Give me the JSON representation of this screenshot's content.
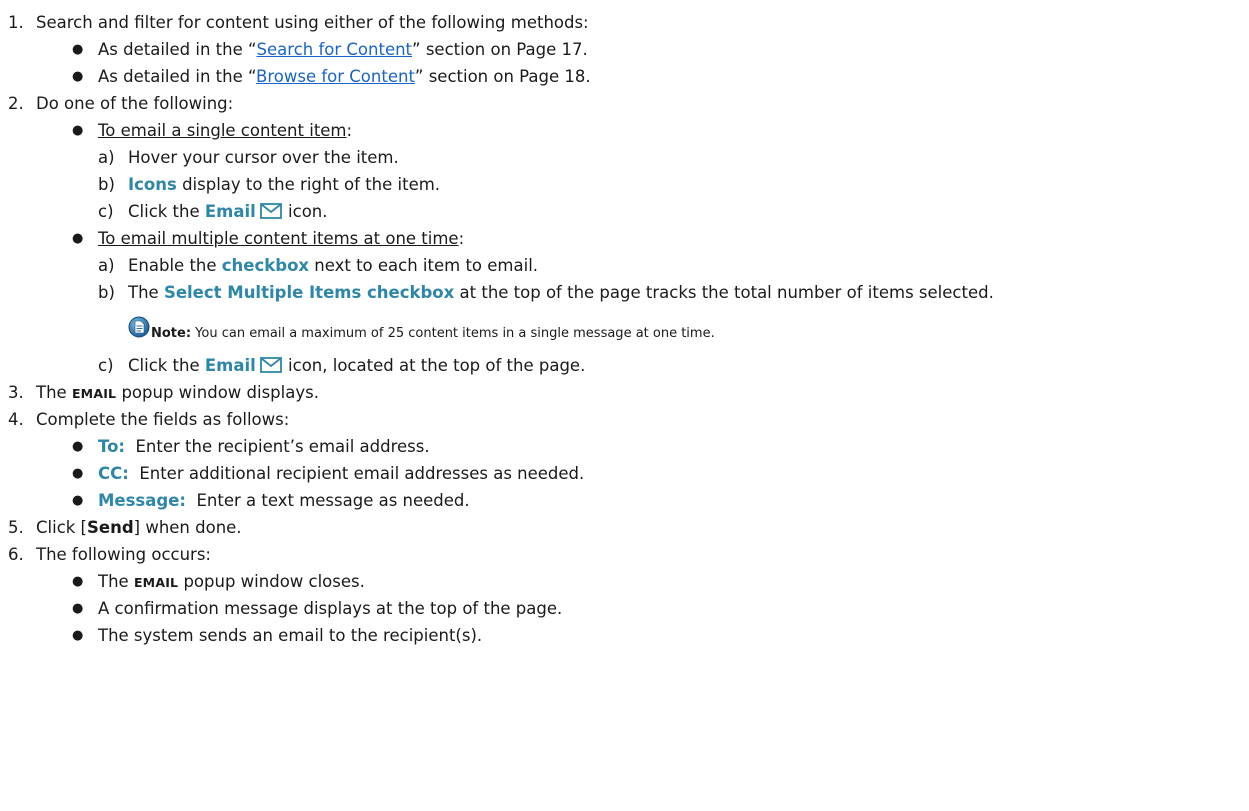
{
  "steps": [
    {
      "num": "1.",
      "text": "Search and filter for content using either of the following methods:",
      "bullets": [
        {
          "pre": "As detailed in the “",
          "link": "Search for Content",
          "post": "” section on Page 17."
        },
        {
          "pre": "As detailed in the “",
          "link": "Browse for Content",
          "post": "” section on Page 18."
        }
      ]
    },
    {
      "num": "2.",
      "text": "Do one of the following:",
      "single": {
        "heading": "To email a single content item",
        "colon": ":",
        "a_label": "a)",
        "a_text": "Hover your cursor over the item.",
        "b_label": "b)",
        "b_hl": "Icons",
        "b_text": " display to the right of the item.",
        "c_label": "c)",
        "c_pre": "Click the ",
        "c_hl": "Email",
        "c_post": " icon."
      },
      "multiple": {
        "heading": "To email multiple content items at one time",
        "colon": ":",
        "a_label": "a)",
        "a_pre": "Enable the ",
        "a_hl": "checkbox",
        "a_post": " next to each item to email.",
        "b_label": "b)",
        "b_pre": "The ",
        "b_hl": "Select Multiple Items checkbox",
        "b_post": " at the top of the page tracks the total number of items selected.",
        "note_label": "Note:",
        "note_text": " You can email a maximum of 25 content items in a single message at one time.",
        "c_label": "c)",
        "c_pre": "Click the ",
        "c_hl": "Email",
        "c_post": " icon, located at the top of the page."
      }
    },
    {
      "num": "3.",
      "pre": "The ",
      "sc": "EMAIL",
      "post": " popup window displays."
    },
    {
      "num": "4.",
      "text": "Complete the fields as follows:",
      "fields": [
        {
          "label": "To:",
          "text": "  Enter the recipient’s email address."
        },
        {
          "label": "CC:",
          "text": "  Enter additional recipient email addresses as needed."
        },
        {
          "label": "Message:",
          "text": "  Enter a text message as needed."
        }
      ]
    },
    {
      "num": "5.",
      "pre": "Click [",
      "strong": "Send",
      "post": "] when done."
    },
    {
      "num": "6.",
      "text": "The following occurs:",
      "results": {
        "r1_pre": "The ",
        "r1_sc": "EMAIL",
        "r1_post": " popup window closes.",
        "r2": "A confirmation message displays at the top of the page.",
        "r3": "The system sends an email to the recipient(s)."
      }
    }
  ],
  "bullet_glyph": "●",
  "colors": {
    "highlight": "#2e86a8",
    "link": "#1a64c8",
    "text": "#1a1a1a"
  },
  "icons": {
    "email": "envelope-icon",
    "note": "note-icon"
  }
}
